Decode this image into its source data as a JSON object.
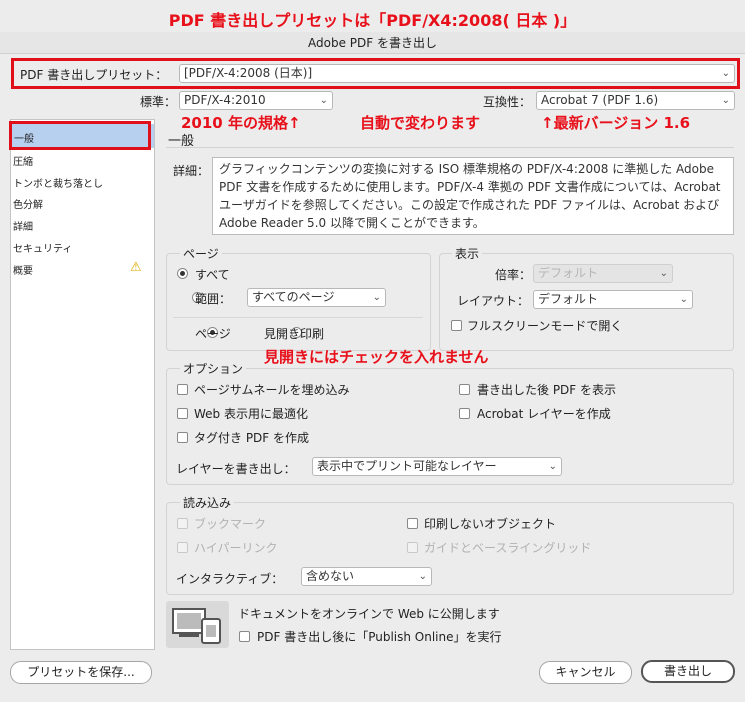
{
  "annotations": {
    "top": "PDF 書き出しプリセットは「PDF/X4:2008( 日本 )」",
    "standard_note": "2010 年の規格↑",
    "auto_note": "自動で変わります",
    "compat_note": "↑最新バージョン 1.6",
    "spreads_note": "見開きにはチェックを入れません"
  },
  "window": {
    "title": "Adobe PDF を書き出し"
  },
  "preset": {
    "label": "PDF 書き出しプリセット：",
    "value": "[PDF/X-4:2008 (日本)]"
  },
  "standard": {
    "label": "標準：",
    "value": "PDF/X-4:2010"
  },
  "compat": {
    "label": "互換性：",
    "value": "Acrobat 7 (PDF 1.6)"
  },
  "sidebar": {
    "items": [
      {
        "label": "一般"
      },
      {
        "label": "圧縮"
      },
      {
        "label": "トンボと裁ち落とし"
      },
      {
        "label": "色分解"
      },
      {
        "label": "詳細"
      },
      {
        "label": "セキュリティ"
      },
      {
        "label": "概要"
      }
    ]
  },
  "general": {
    "heading": "一般",
    "desc_label": "詳細：",
    "description": "グラフィックコンテンツの変換に対する ISO 標準規格の PDF/X-4:2008 に準拠した Adobe PDF 文書を作成するために使用します。PDF/X-4 準拠の PDF 文書作成については、Acrobat ユーザガイドを参照してください。この設定で作成された PDF ファイルは、Acrobat および Adobe Reader 5.0 以降で開くことができます。"
  },
  "pages": {
    "title": "ページ",
    "all": "すべて",
    "range": "範囲：",
    "range_value": "すべてのページ",
    "pages_opt": "ページ",
    "spreads_opt": "見開き印刷"
  },
  "display": {
    "title": "表示",
    "zoom_label": "倍率：",
    "zoom_value": "デフォルト",
    "layout_label": "レイアウト：",
    "layout_value": "デフォルト",
    "fullscreen": "フルスクリーンモードで開く"
  },
  "options": {
    "title": "オプション",
    "embed_thumbs": "ページサムネールを埋め込み",
    "optimize_web": "Web 表示用に最適化",
    "tagged_pdf": "タグ付き PDF を作成",
    "view_after": "書き出した後 PDF を表示",
    "acrobat_layers": "Acrobat レイヤーを作成",
    "layers_label": "レイヤーを書き出し：",
    "layers_value": "表示中でプリント可能なレイヤー"
  },
  "include": {
    "title": "読み込み",
    "bookmarks": "ブックマーク",
    "hyperlinks": "ハイパーリンク",
    "nonprinting": "印刷しないオブジェクト",
    "guides": "ガイドとベースライングリッド",
    "interactive_label": "インタラクティブ：",
    "interactive_value": "含めない"
  },
  "publish": {
    "title": "ドキュメントをオンラインで Web に公開します",
    "checkbox": "PDF 書き出し後に「Publish Online」を実行"
  },
  "buttons": {
    "save_preset": "プリセットを保存...",
    "cancel": "キャンセル",
    "export": "書き出し"
  }
}
